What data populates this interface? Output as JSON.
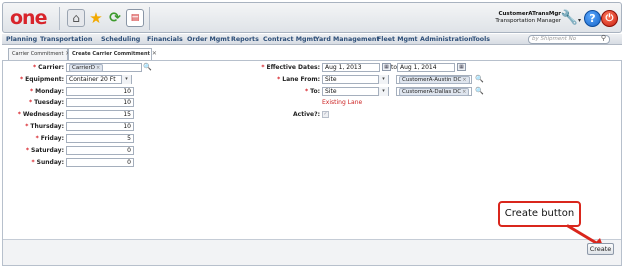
{
  "header": {
    "logo": "one",
    "user": {
      "name": "CustomerATransMgr",
      "role": "Transportation Manager"
    },
    "icons": [
      "home-icon",
      "star-icon",
      "refresh-icon",
      "report-icon",
      "wrench-icon",
      "help-icon",
      "power-icon"
    ],
    "help_glyph": "?"
  },
  "menu": {
    "items": [
      "Planning",
      "Transportation",
      "Scheduling",
      "Financials",
      "Order Mgmt",
      "Reports",
      "Contract Mgmt",
      "Yard Management",
      "Fleet Mgmt",
      "Administration",
      "Tools"
    ],
    "search_placeholder": "by Shipment No"
  },
  "tabs": [
    {
      "label": "Carrier Commitment",
      "active": false
    },
    {
      "label": "Create Carrier Commitment",
      "active": true
    }
  ],
  "form": {
    "carrier": {
      "label": "Carrier:",
      "token": "CarrierD"
    },
    "equipment": {
      "label": "Equipment:",
      "value": "Container 20 Ft"
    },
    "days": [
      {
        "label": "Monday:",
        "value": "10"
      },
      {
        "label": "Tuesday:",
        "value": "10"
      },
      {
        "label": "Wednesday:",
        "value": "15"
      },
      {
        "label": "Thursday:",
        "value": "10"
      },
      {
        "label": "Friday:",
        "value": "5"
      },
      {
        "label": "Saturday:",
        "value": "0"
      },
      {
        "label": "Sunday:",
        "value": "0"
      }
    ],
    "effective_dates": {
      "label": "Effective Dates:",
      "from": "Aug 1, 2013",
      "to_label": "to",
      "to": "Aug 1, 2014"
    },
    "lane_from": {
      "label": "Lane From:",
      "type": "Site",
      "token": "CustomerA-Austin DC"
    },
    "lane_to": {
      "label": "To:",
      "type": "Site",
      "token": "CustomerA-Dallas DC"
    },
    "existing_lane": "Existing Lane",
    "active": {
      "label": "Active?:",
      "checked": true
    }
  },
  "annotation": {
    "text": "Create button"
  },
  "footer": {
    "create_label": "Create"
  },
  "colors": {
    "required": "#d8242b",
    "callout": "#d9261c",
    "menu_text": "#2e4f78"
  }
}
